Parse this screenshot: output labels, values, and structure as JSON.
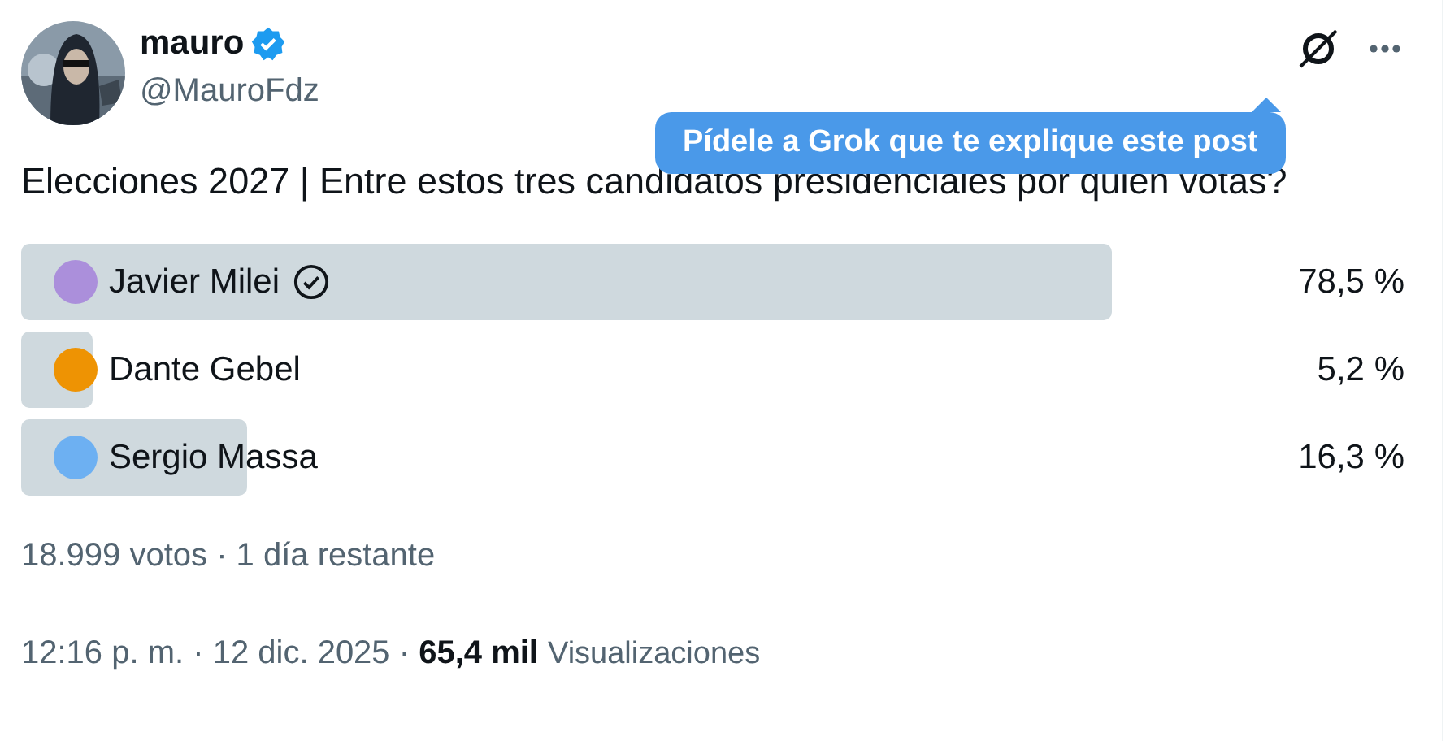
{
  "author": {
    "name": "mauro",
    "verified": true,
    "handle": "@MauroFdz"
  },
  "tooltip": {
    "text": "Pídele a Grok que te explique este post"
  },
  "text": "Elecciones 2027 | Entre estos tres candidatos presidenciales por quien votas?",
  "poll": {
    "options": [
      {
        "label": "Javier Milei",
        "selected": true,
        "level": 0.785,
        "percent": "78,5 %",
        "color": "#ab8fdb"
      },
      {
        "label": "Dante Gebel",
        "selected": false,
        "level": 0.052,
        "percent": "5,2 %",
        "color": "#ee9303"
      },
      {
        "label": "Sergio Massa",
        "selected": false,
        "level": 0.163,
        "percent": "16,3 %",
        "color": "#6db0f2"
      }
    ],
    "summary": "18.999 votos · 1 día restante"
  },
  "meta": {
    "time": "12:16 p. m. · 12 dic. 2025 · ",
    "views_count": "65,4 mil",
    "views_label": "Visualizaciones"
  }
}
